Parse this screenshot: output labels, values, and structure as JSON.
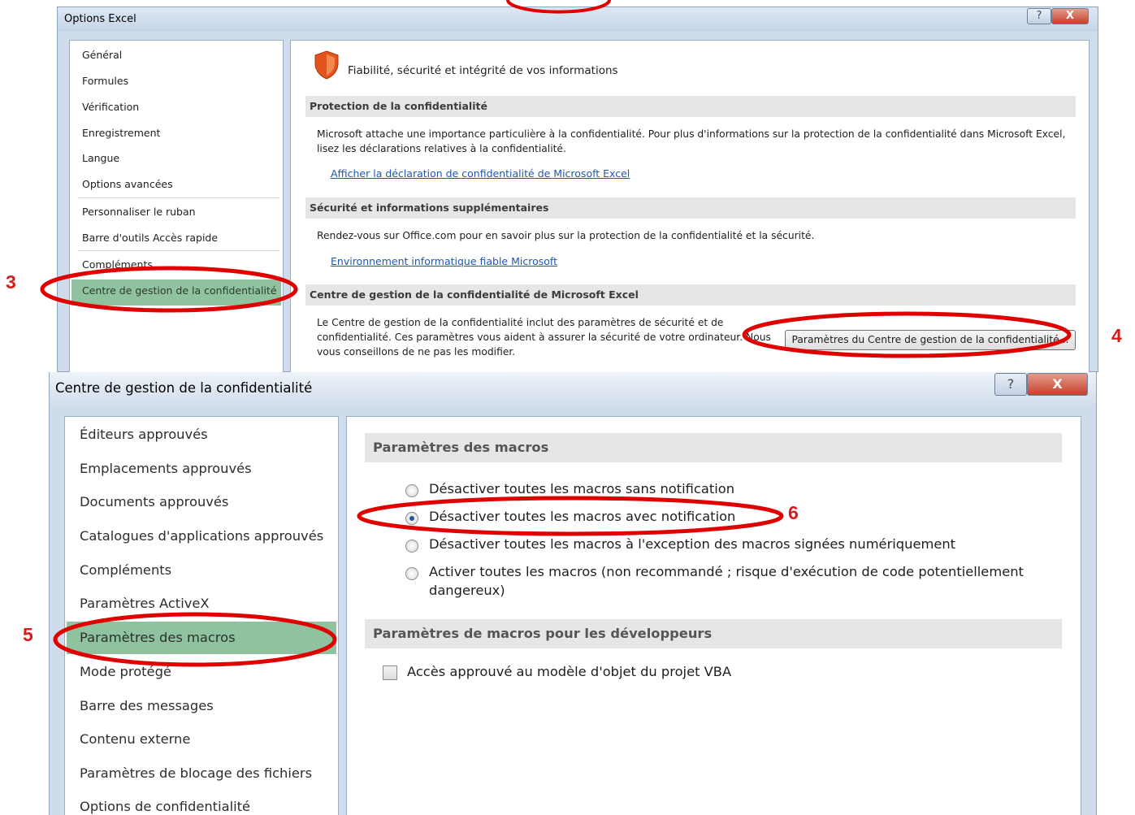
{
  "options_window": {
    "title": "Options Excel",
    "help_label": "?",
    "close_label": "X",
    "nav_items": [
      "Général",
      "Formules",
      "Vérification",
      "Enregistrement",
      "Langue",
      "Options avancées",
      "Personnaliser le ruban",
      "Barre d'outils Accès rapide",
      "Compléments",
      "Centre de gestion de la confidentialité"
    ],
    "active_nav_index": 9,
    "heading": "Fiabilité, sécurité et intégrité de vos informations",
    "sections": [
      {
        "title": "Protection de la confidentialité",
        "text_line1": "Microsoft attache une importance particulière à la confidentialité. Pour plus d'informations sur la protection de la confidentialité dans Microsoft Excel,",
        "text_line2": "lisez les déclarations relatives à la confidentialité.",
        "link": "Afficher la déclaration de confidentialité de Microsoft Excel"
      },
      {
        "title": "Sécurité et informations supplémentaires",
        "text_line1": "Rendez-vous sur Office.com pour en savoir plus sur la protection de la confidentialité et la sécurité.",
        "link": "Environnement informatique fiable Microsoft"
      },
      {
        "title": "Centre de gestion de la confidentialité de Microsoft Excel",
        "text_line1": "Le Centre de gestion de la confidentialité inclut des paramètres de sécurité et de",
        "text_line2": "confidentialité. Ces paramètres vous aident à assurer la sécurité de votre ordinateur. Nous",
        "text_line3": "vous conseillons de ne pas les modifier.",
        "button": "Paramètres du Centre de gestion de la confidentialité..."
      }
    ]
  },
  "trust_center_window": {
    "title": "Centre de gestion de la confidentialité",
    "help_label": "?",
    "close_label": "X",
    "nav_items": [
      "Éditeurs approuvés",
      "Emplacements approuvés",
      "Documents approuvés",
      "Catalogues d'applications approuvés",
      "Compléments",
      "Paramètres ActiveX",
      "Paramètres des macros",
      "Mode protégé",
      "Barre des messages",
      "Contenu externe",
      "Paramètres de blocage des fichiers",
      "Options de confidentialité"
    ],
    "active_nav_index": 6,
    "macro_section_title": "Paramètres des macros",
    "macro_options": [
      {
        "label": "Désactiver toutes les macros sans notification",
        "checked": false
      },
      {
        "label": "Désactiver toutes les macros avec notification",
        "checked": true
      },
      {
        "label": "Désactiver toutes les macros à l'exception des macros signées numériquement",
        "checked": false
      },
      {
        "label": "Activer toutes les macros (non recommandé ; risque d'exécution de code potentiellement dangereux)",
        "checked": false
      }
    ],
    "dev_section_title": "Paramètres de macros pour les développeurs",
    "vba_checkbox_label": "Accès approuvé au modèle d'objet du projet VBA",
    "vba_checked": false
  },
  "annotations": {
    "step3": "3",
    "step4": "4",
    "step5": "5",
    "step6": "6",
    "highlight_color": "#e00000",
    "active_item_color": "#8fc3a0"
  }
}
